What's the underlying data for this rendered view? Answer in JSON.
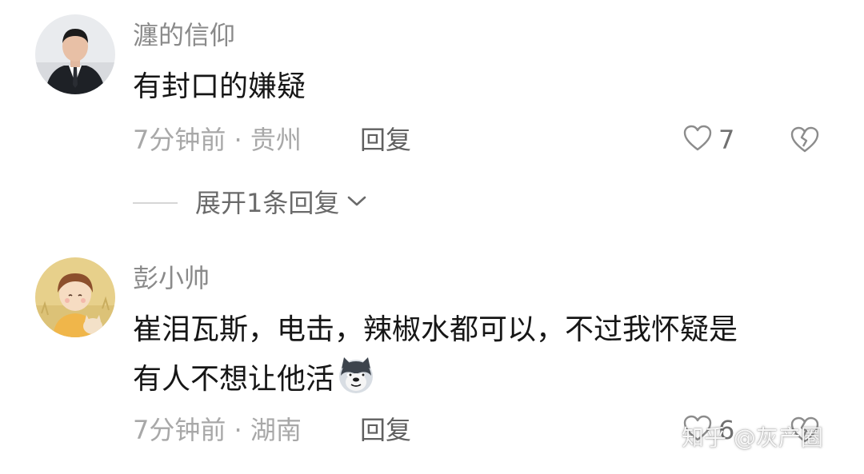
{
  "comments": [
    {
      "username": "瀍的信仰",
      "content": "有封口的嫌疑",
      "meta": "7分钟前 · 贵州",
      "reply_label": "回复",
      "like_count": "7",
      "avatar_icon": "avatar-man-in-suit",
      "expand_label": "展开1条回复"
    },
    {
      "username": "彭小帅",
      "content_line1": "崔泪瓦斯，电击，辣椒水都可以，不过我怀疑是",
      "content_line2": "有人不想让他活",
      "emoji_icon": "doge-emoji",
      "meta": "7分钟前 · 湖南",
      "reply_label": "回复",
      "like_count": "6",
      "avatar_icon": "avatar-cartoon-child"
    }
  ],
  "watermark": "知乎 @灰产圈",
  "colors": {
    "username": "#8a8a8a",
    "content": "#161616",
    "meta": "#a8a8a8",
    "reply": "#606060"
  }
}
